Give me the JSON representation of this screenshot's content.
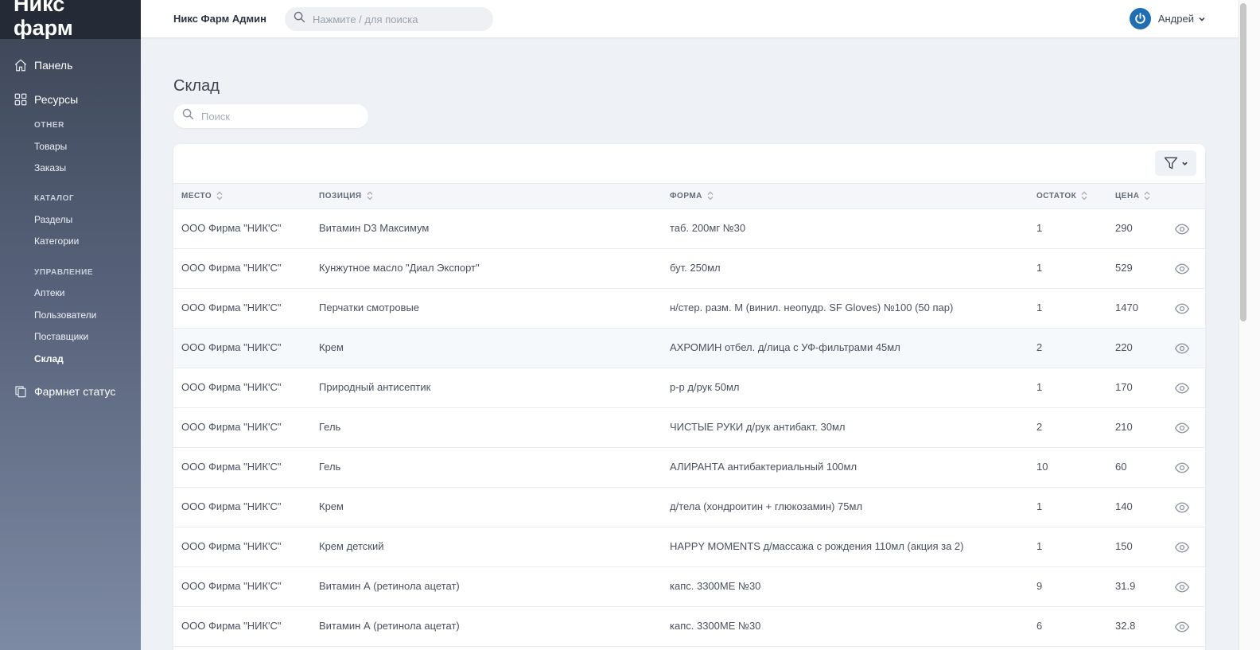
{
  "app": {
    "logo": "Никс фарм",
    "brand": "Никс Фарм Админ",
    "global_search_placeholder": "Нажмите / для поиска",
    "user_name": "Андрей"
  },
  "sidebar": {
    "panel": "Панель",
    "resources": "Ресурсы",
    "sections": [
      {
        "heading": "Other",
        "items": [
          "Товары",
          "Заказы"
        ]
      },
      {
        "heading": "Каталог",
        "items": [
          "Разделы",
          "Категории"
        ]
      },
      {
        "heading": "Управление",
        "items": [
          "Аптеки",
          "Пользователи",
          "Поставщики",
          "Склад"
        ]
      }
    ],
    "farmnet": "Фармнет статус",
    "active_item": "Склад"
  },
  "page": {
    "title": "Склад",
    "search_placeholder": "Поиск"
  },
  "table": {
    "columns": [
      "Место",
      "Позиция",
      "Форма",
      "Остаток",
      "Цена"
    ],
    "rows": [
      [
        "ООО Фирма \"НИК'С\"",
        "Витамин D3 Максимум",
        "таб. 200мг №30",
        "1",
        "290"
      ],
      [
        "ООО Фирма \"НИК'С\"",
        "Кунжутное масло \"Диал Экспорт\"",
        "бут. 250мл",
        "1",
        "529"
      ],
      [
        "ООО Фирма \"НИК'С\"",
        "Перчатки смотровые",
        "н/стер. разм. M (винил. неопудр. SF Gloves) №100 (50 пар)",
        "1",
        "1470"
      ],
      [
        "ООО Фирма \"НИК'С\"",
        "Крем",
        "АХРОМИН отбел. д/лица с УФ-фильтрами 45мл",
        "2",
        "220"
      ],
      [
        "ООО Фирма \"НИК'С\"",
        "Природный антисептик",
        "р-р д/рук 50мл",
        "1",
        "170"
      ],
      [
        "ООО Фирма \"НИК'С\"",
        "Гель",
        "ЧИСТЫЕ РУКИ д/рук антибакт. 30мл",
        "2",
        "210"
      ],
      [
        "ООО Фирма \"НИК'С\"",
        "Гель",
        "АЛИРАНТА антибактериальный 100мл",
        "10",
        "60"
      ],
      [
        "ООО Фирма \"НИК'С\"",
        "Крем",
        "д/тела (хондроитин + глюкозамин) 75мл",
        "1",
        "140"
      ],
      [
        "ООО Фирма \"НИК'С\"",
        "Крем детский",
        "HAPPY MOMENTS д/массажа с рождения 110мл (акция за 2)",
        "1",
        "150"
      ],
      [
        "ООО Фирма \"НИК'С\"",
        "Витамин А (ретинола ацетат)",
        "капс. 3300МЕ №30",
        "9",
        "31.9"
      ],
      [
        "ООО Фирма \"НИК'С\"",
        "Витамин А (ретинола ацетат)",
        "капс. 3300МЕ №30",
        "6",
        "32.8"
      ]
    ],
    "highlighted_row": 3
  },
  "colors": {
    "sidebar_top": "#3c4555",
    "sidebar_bottom": "#7d8aa3",
    "logo_bg": "#242b36",
    "accent": "#1f6fb2",
    "page_bg": "#eef1f5"
  },
  "icons": [
    "home-icon",
    "grid-icon",
    "copy-icon",
    "search-icon",
    "power-icon",
    "filter-icon",
    "sort-icon",
    "eye-icon",
    "chevron-down-icon"
  ]
}
